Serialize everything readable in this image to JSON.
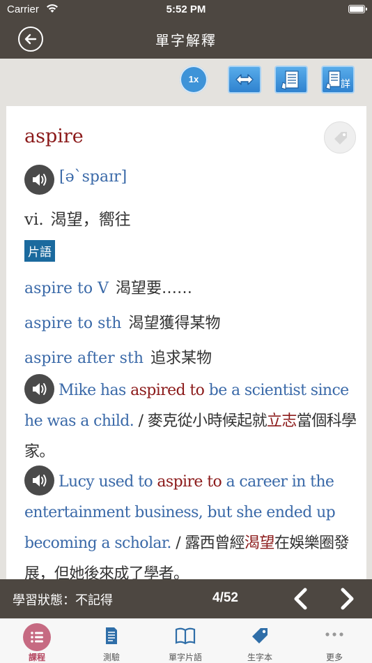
{
  "status_bar": {
    "carrier": "Carrier",
    "time": "5:52 PM"
  },
  "nav": {
    "title": "單字解釋"
  },
  "toolbar": {
    "speed_label": "1x"
  },
  "entry": {
    "word": "aspire",
    "pronunciation": "[əˋspaɪr]",
    "part_of_speech": "vi.",
    "definition": "渴望，嚮往",
    "phrase_badge": "片語",
    "phrases": [
      {
        "en": "aspire to V",
        "zh": "渴望要……"
      },
      {
        "en": "aspire to sth",
        "zh": "渴望獲得某物"
      },
      {
        "en": "aspire after sth",
        "zh": "追求某物"
      }
    ],
    "examples": [
      {
        "en_before": "Mike has ",
        "en_highlight": "aspired to",
        "en_after": " be a scientist since he was a child.",
        "zh_before": " / 麥克從小時候起就",
        "zh_highlight": "立志",
        "zh_after": "當個科學家。"
      },
      {
        "en_before": "Lucy used to ",
        "en_highlight": "aspire to",
        "en_after": " a career in the entertainment business, but she ended up becoming a scholar.",
        "zh_before": " / 露西曾經",
        "zh_highlight": "渴望",
        "zh_after": "在娛樂圈發展，但她後來成了學者。"
      }
    ]
  },
  "bottom_status": {
    "learning_status": "學習狀態：不記得",
    "page": "4/52"
  },
  "tabs": [
    {
      "label": "課程",
      "icon": "list-icon",
      "active": true
    },
    {
      "label": "測驗",
      "icon": "document-icon",
      "active": false
    },
    {
      "label": "單字片語",
      "icon": "book-icon",
      "active": false
    },
    {
      "label": "生字本",
      "icon": "tag-icon",
      "active": false
    },
    {
      "label": "更多",
      "icon": "more-icon",
      "active": false
    }
  ],
  "colors": {
    "header": "#4d4741",
    "headword": "#8b1a1a",
    "english_text": "#3a69a8",
    "phrase_badge": "#1b6a9e",
    "toolbar_button": "#3e93d8",
    "active_tab": "#c66a82"
  }
}
